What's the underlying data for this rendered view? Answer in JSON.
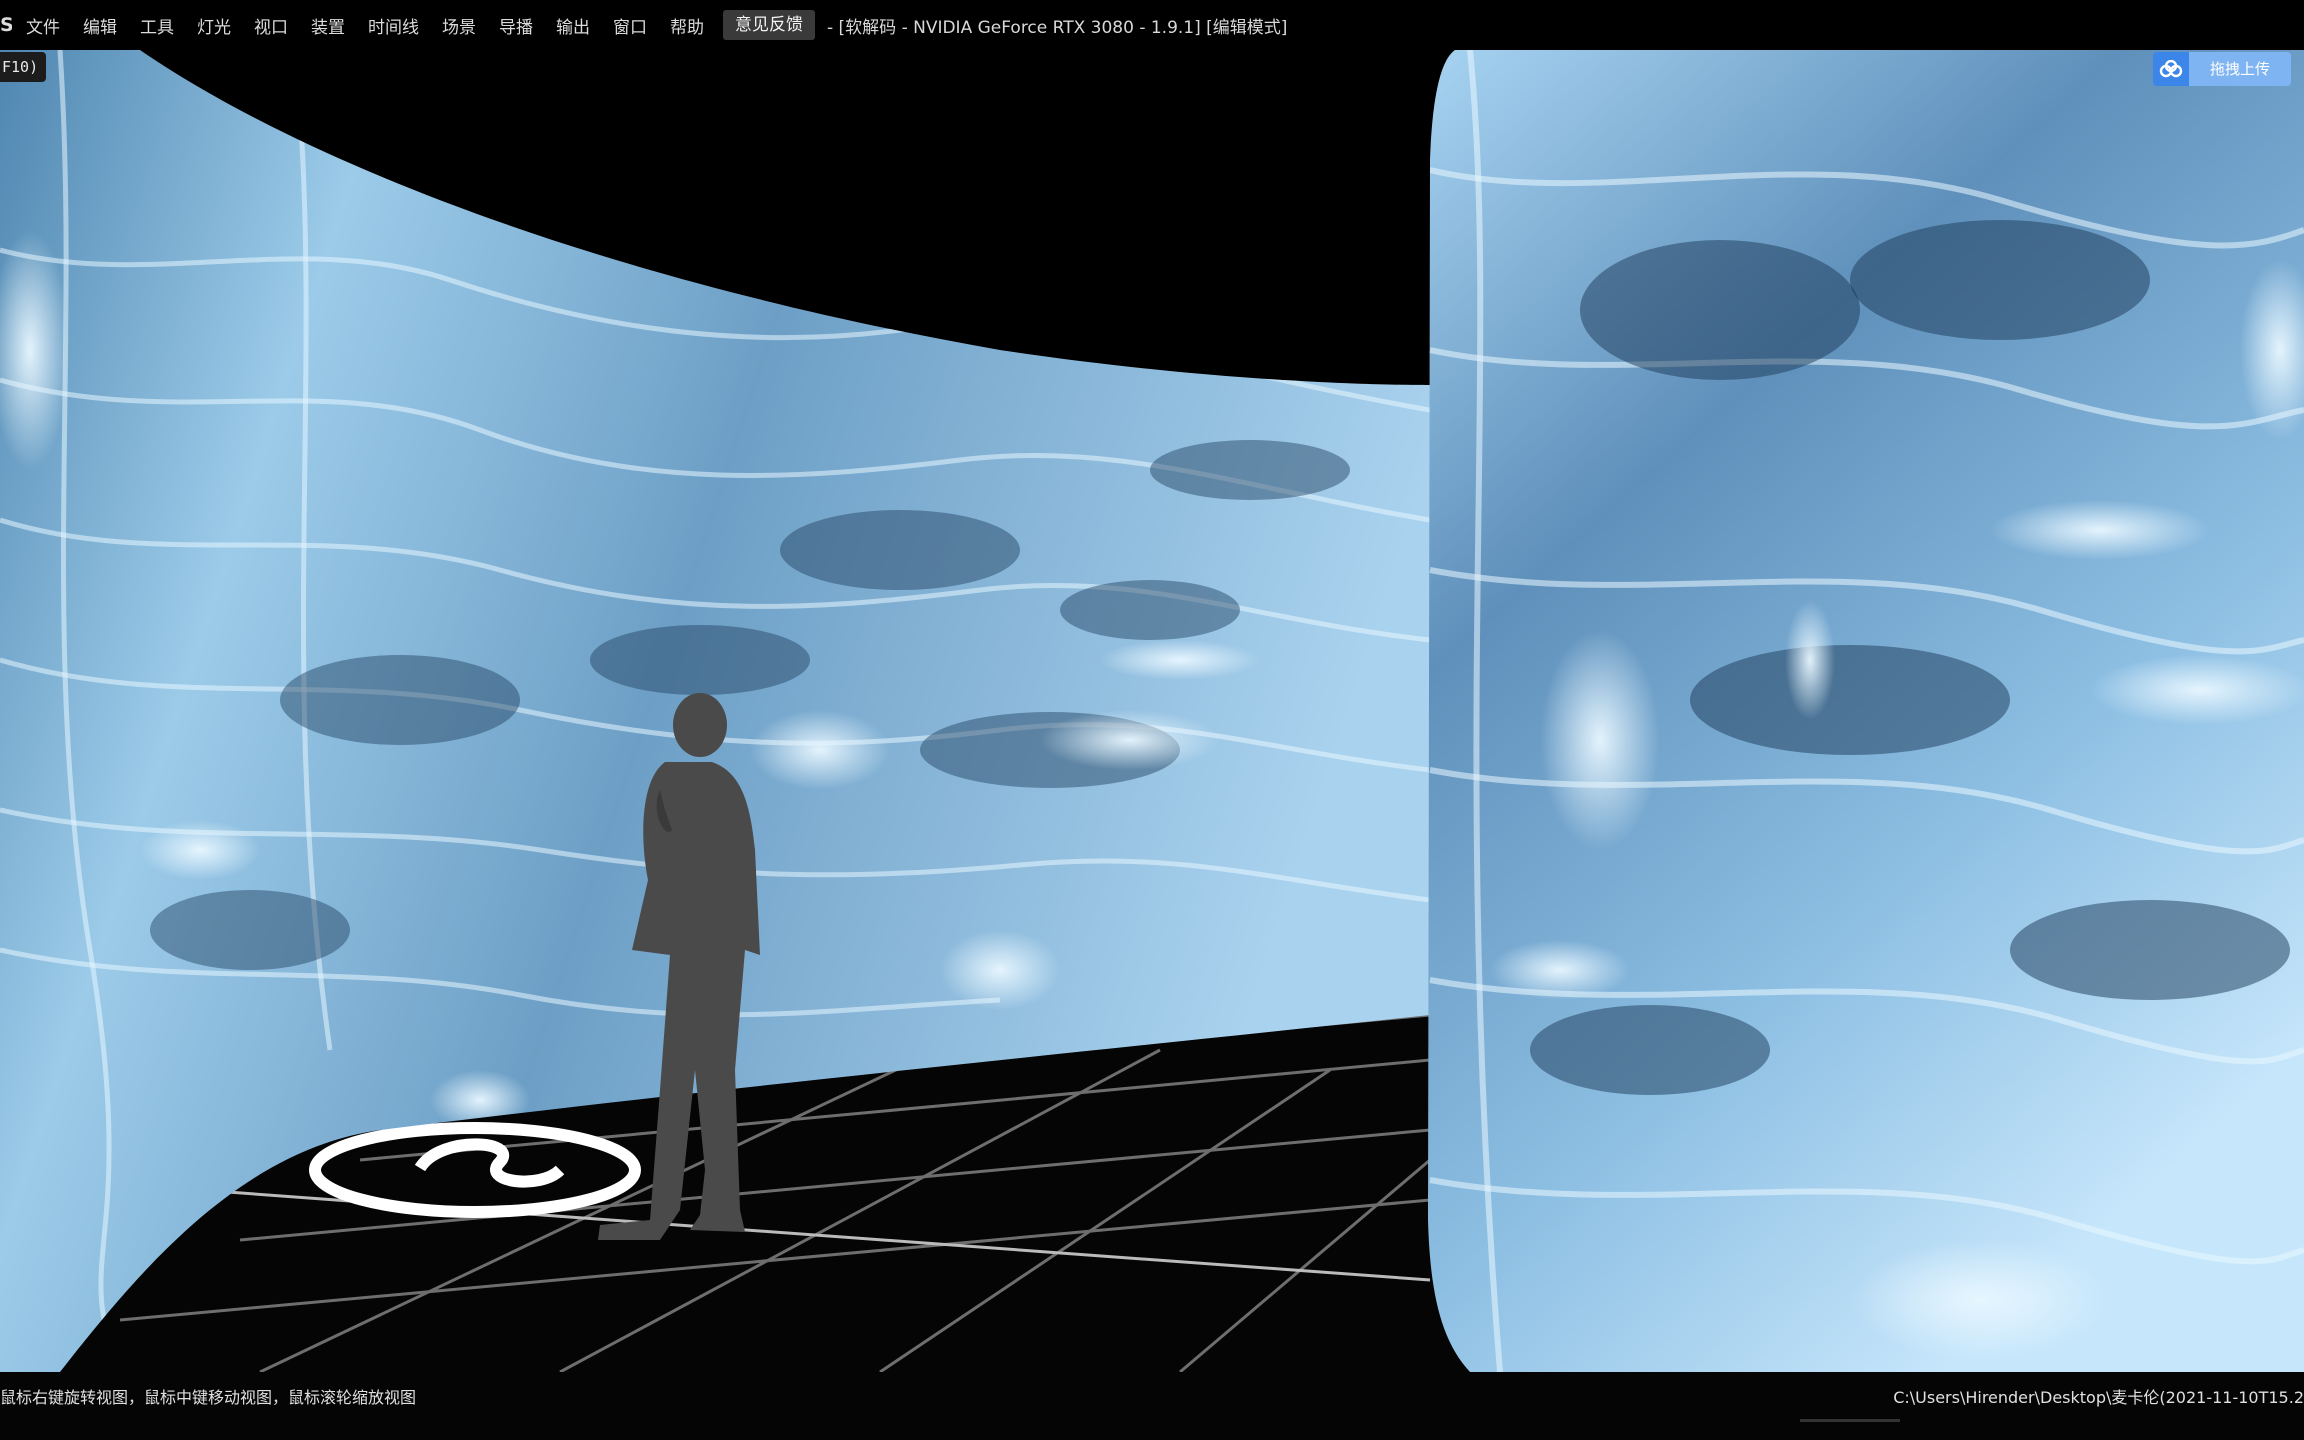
{
  "menubar": {
    "app_glyph": "S",
    "items": [
      "文件",
      "编辑",
      "工具",
      "灯光",
      "视口",
      "装置",
      "时间线",
      "场景",
      "导播",
      "输出",
      "窗口",
      "帮助"
    ],
    "feedback_label": "意见反馈",
    "title": "- [软解码 - NVIDIA GeForce RTX 3080 - 1.9.1] [编辑模式]"
  },
  "viewport": {
    "f10_tag": "F10)",
    "upload_label": "拖拽上传",
    "colors": {
      "water_light": "#bfe4ff",
      "water_mid": "#5d8fb8",
      "water_dark": "#1c3a55",
      "floor": "#050505",
      "grid": "#7a7a7a"
    }
  },
  "statusbar": {
    "hint": "鼠标右键旋转视图，鼠标中键移动视图，鼠标滚轮缩放视图",
    "path": "C:\\Users\\Hirender\\Desktop\\麦卡伦(2021-11-10T15.2"
  },
  "icons": {
    "upload": "cloud-upload-icon",
    "logo": "floor-logo-icon"
  }
}
